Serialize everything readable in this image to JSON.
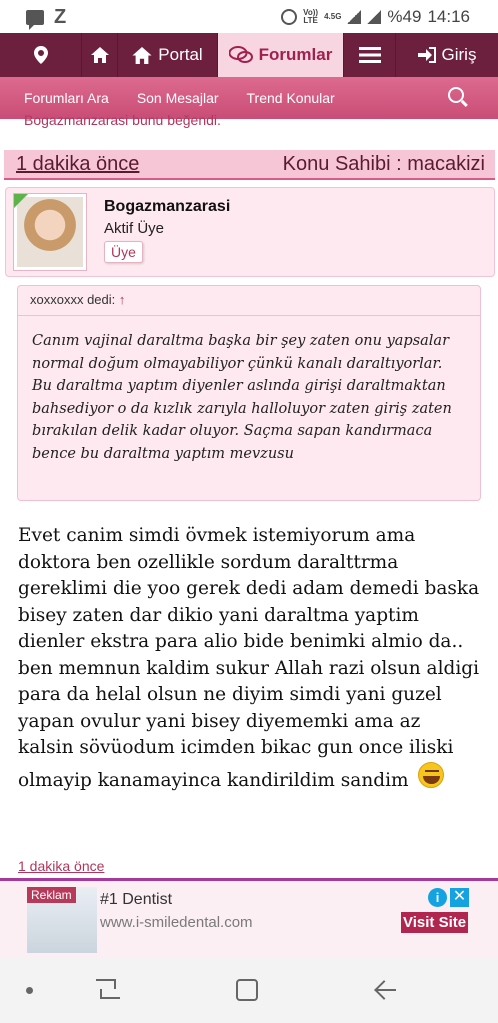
{
  "status_bar": {
    "network_top": "Vo))",
    "network_bottom": "LTE",
    "net_type": "4.5G",
    "battery": "%49",
    "time": "14:16"
  },
  "top_nav": {
    "location_icon": "map-marker-icon",
    "home_icon": "home-icon",
    "portal_label": "Portal",
    "forumlar_label": "Forumlar",
    "menu_icon": "hamburger-icon",
    "giris_label": "Giriş"
  },
  "sub_nav": {
    "items": [
      {
        "label": "Forumları Ara"
      },
      {
        "label": "Son Mesajlar"
      },
      {
        "label": "Trend Konular"
      }
    ]
  },
  "cut_text": "Bogazmanzarasi bunu beğendi.",
  "post": {
    "time": "1 dakika önce",
    "owner": "Konu Sahibi : macakizi",
    "author": {
      "name": "Bogazmanzarasi",
      "title": "Aktif Üye",
      "badge": "Üye"
    },
    "quote": {
      "header": "xoxxoxxx dedi:",
      "arrow": "↑",
      "text": "Canım vajinal daraltma başka bir şey zaten onu yapsalar normal doğum olmayabiliyor çünkü kanalı daraltıyorlar. Bu daraltma yaptım diyenler aslında girişi daraltmaktan bahsediyor o da kızlık zarıyla halloluyor zaten giriş zaten bırakılan delik kadar oluyor. Saçma sapan kandırmaca bence bu daraltma yaptım mevzusu"
    },
    "body": "Evet canim simdi övmek istemiyorum ama doktora ben ozellikle sordum daralttrma gereklimi die yoo gerek dedi adam demedi baska bisey zaten dar dikio yani daraltma yaptim dienler ekstra para alio bide benimki almio da.. ben memnun kaldim sukur Allah razi olsun aldigi para da helal olsun ne diyim simdi yani guzel yapan ovulur yani bisey diyememki ama az kalsin sövüodum icimden bikac gun once iliski olmayip kanamayinca kandirildim sandim",
    "footer_time": "1 dakika önce"
  },
  "ad": {
    "label": "Reklam",
    "title": "#1 Dentist",
    "url": "www.i-smiledental.com",
    "cta": "Visit Site",
    "info": "i",
    "close": "✕"
  },
  "colors": {
    "nav_bg": "#6d1f3e",
    "subnav_bg": "#d6567f",
    "accent": "#b0375c"
  }
}
